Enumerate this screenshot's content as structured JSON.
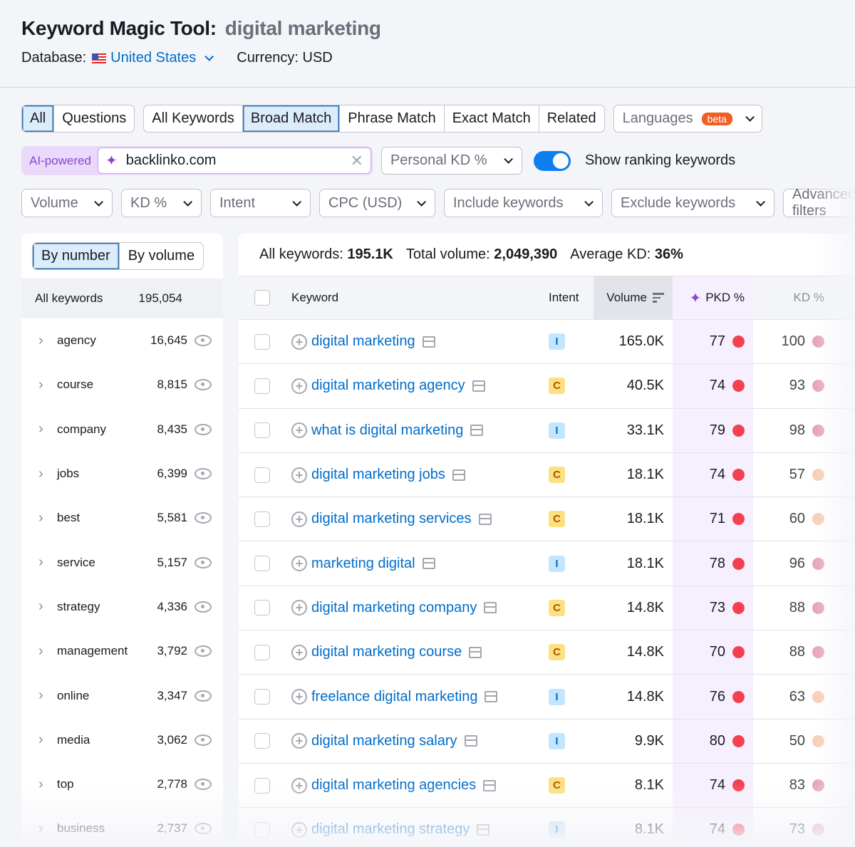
{
  "header": {
    "title": "Keyword Magic Tool:",
    "query": "digital marketing",
    "database_label": "Database:",
    "database_value": "United States",
    "currency": "Currency: USD"
  },
  "tabs_questions": [
    {
      "label": "All",
      "active": true
    },
    {
      "label": "Questions",
      "active": false
    }
  ],
  "tabs_match": [
    {
      "label": "All Keywords",
      "active": false
    },
    {
      "label": "Broad Match",
      "active": true
    },
    {
      "label": "Phrase Match",
      "active": false
    },
    {
      "label": "Exact Match",
      "active": false
    },
    {
      "label": "Related",
      "active": false
    }
  ],
  "languages": {
    "label": "Languages",
    "badge": "beta"
  },
  "ai": {
    "label": "AI-powered",
    "value": "backlinko.com"
  },
  "personal_kd": "Personal KD %",
  "toggle": {
    "label": "Show ranking keywords",
    "on": true
  },
  "filters": [
    "Volume",
    "KD %",
    "Intent",
    "CPC (USD)",
    "Include keywords",
    "Exclude keywords",
    "Advanced filters"
  ],
  "sidebar": {
    "tabs": [
      {
        "label": "By number",
        "active": true
      },
      {
        "label": "By volume",
        "active": false
      }
    ],
    "all_label": "All keywords",
    "all_count": "195,054",
    "groups": [
      {
        "label": "agency",
        "count": "16,645"
      },
      {
        "label": "course",
        "count": "8,815"
      },
      {
        "label": "company",
        "count": "8,435"
      },
      {
        "label": "jobs",
        "count": "6,399"
      },
      {
        "label": "best",
        "count": "5,581"
      },
      {
        "label": "service",
        "count": "5,157"
      },
      {
        "label": "strategy",
        "count": "4,336"
      },
      {
        "label": "management",
        "count": "3,792"
      },
      {
        "label": "online",
        "count": "3,347"
      },
      {
        "label": "media",
        "count": "3,062"
      },
      {
        "label": "top",
        "count": "2,778"
      },
      {
        "label": "business",
        "count": "2,737"
      }
    ]
  },
  "stats": {
    "all_label": "All keywords:",
    "all_value": "195.1K",
    "vol_label": "Total volume:",
    "vol_value": "2,049,390",
    "kd_label": "Average KD:",
    "kd_value": "36%"
  },
  "table": {
    "headers": {
      "keyword": "Keyword",
      "intent": "Intent",
      "volume": "Volume",
      "pkd": "PKD %",
      "kd": "KD %"
    },
    "colors": {
      "pkd_dot": "#f5404f",
      "kd_high": "#e7a1b3",
      "kd_mid": "#f7cdb4"
    },
    "rows": [
      {
        "keyword": "digital marketing",
        "intent": "I",
        "volume": "165.0K",
        "pkd": "77",
        "kd": "100"
      },
      {
        "keyword": "digital marketing agency",
        "intent": "C",
        "volume": "40.5K",
        "pkd": "74",
        "kd": "93"
      },
      {
        "keyword": "what is digital marketing",
        "intent": "I",
        "volume": "33.1K",
        "pkd": "79",
        "kd": "98"
      },
      {
        "keyword": "digital marketing jobs",
        "intent": "C",
        "volume": "18.1K",
        "pkd": "74",
        "kd": "57"
      },
      {
        "keyword": "digital marketing services",
        "intent": "C",
        "volume": "18.1K",
        "pkd": "71",
        "kd": "60"
      },
      {
        "keyword": "marketing digital",
        "intent": "I",
        "volume": "18.1K",
        "pkd": "78",
        "kd": "96"
      },
      {
        "keyword": "digital marketing company",
        "intent": "C",
        "volume": "14.8K",
        "pkd": "73",
        "kd": "88"
      },
      {
        "keyword": "digital marketing course",
        "intent": "C",
        "volume": "14.8K",
        "pkd": "70",
        "kd": "88"
      },
      {
        "keyword": "freelance digital marketing",
        "intent": "I",
        "volume": "14.8K",
        "pkd": "76",
        "kd": "63"
      },
      {
        "keyword": "digital marketing salary",
        "intent": "I",
        "volume": "9.9K",
        "pkd": "80",
        "kd": "50"
      },
      {
        "keyword": "digital marketing agencies",
        "intent": "C",
        "volume": "8.1K",
        "pkd": "74",
        "kd": "83"
      },
      {
        "keyword": "digital marketing strategy",
        "intent": "I",
        "volume": "8.1K",
        "pkd": "74",
        "kd": "73"
      }
    ]
  }
}
